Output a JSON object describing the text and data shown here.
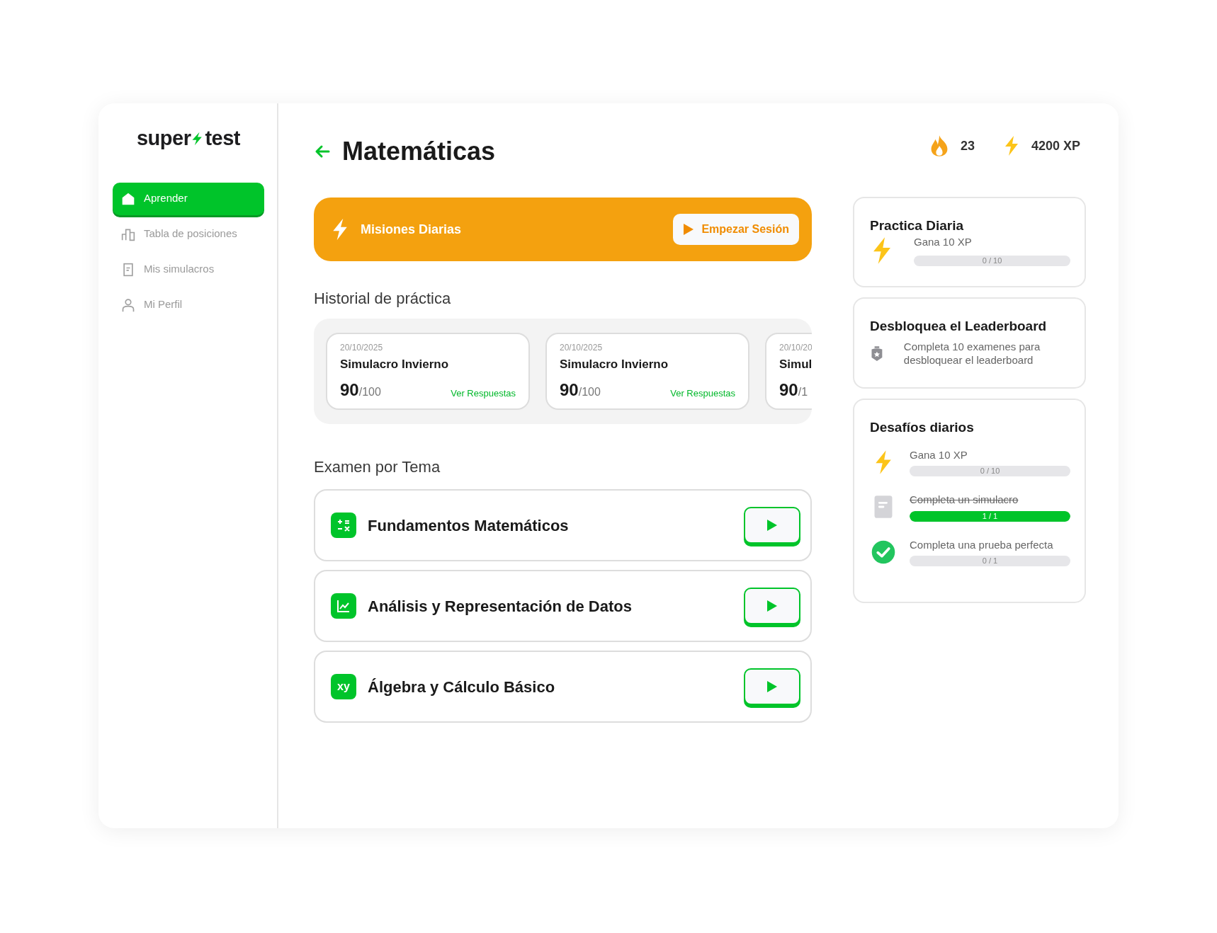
{
  "logo": {
    "left": "super",
    "right": "test"
  },
  "sidebar": {
    "items": [
      {
        "label": "Aprender",
        "kind": "home",
        "selected": true
      },
      {
        "label": "Tabla de posiciones",
        "kind": "chart",
        "selected": false
      },
      {
        "label": "Mis simulacros",
        "kind": "doc",
        "selected": false
      },
      {
        "label": "Mi Perfil",
        "kind": "user",
        "selected": false
      }
    ]
  },
  "header": {
    "title": "Matemáticas",
    "streak": "23",
    "xp": "4200 XP"
  },
  "banner": {
    "title": "Misiones Diarias",
    "button": "Empezar Sesión"
  },
  "history": {
    "title": "Historial de práctica",
    "cards": [
      {
        "date": "20/10/2025",
        "name": "Simulacro Invierno",
        "score": "90",
        "total": "/100",
        "link": "Ver Respuestas"
      },
      {
        "date": "20/10/2025",
        "name": "Simulacro Invierno",
        "score": "90",
        "total": "/100",
        "link": "Ver Respuestas"
      },
      {
        "date": "20/10/20",
        "name": "Simul",
        "score": "90",
        "total": "/1"
      }
    ]
  },
  "topics": {
    "title": "Examen por Tema",
    "items": [
      {
        "name": "Fundamentos Matemáticos",
        "kind": "calc"
      },
      {
        "name": "Análisis y Representación de Datos",
        "kind": "chart"
      },
      {
        "name": "Álgebra y Cálculo Básico",
        "kind": "xy",
        "icon_text": "xy"
      }
    ]
  },
  "daily_practice": {
    "title": "Practica Diaria",
    "label": "Gana 10 XP",
    "progress": "0 / 10",
    "level": 0
  },
  "unlock": {
    "title": "Desbloquea el Leaderboard",
    "text": "Completa 10 examenes para desbloquear el leaderboard"
  },
  "challenges": {
    "title": "Desafíos diarios",
    "items": [
      {
        "kind": "bolt",
        "label": "Gana 10 XP",
        "progress": "0 / 10",
        "level": 0,
        "done": false
      },
      {
        "kind": "doc",
        "label": "Completa un simulacro",
        "progress": "1 / 1",
        "level": 1,
        "done": true
      },
      {
        "kind": "check",
        "label": "Completa una prueba perfecta",
        "progress": "0 / 1",
        "level": 0,
        "done": false
      }
    ]
  }
}
